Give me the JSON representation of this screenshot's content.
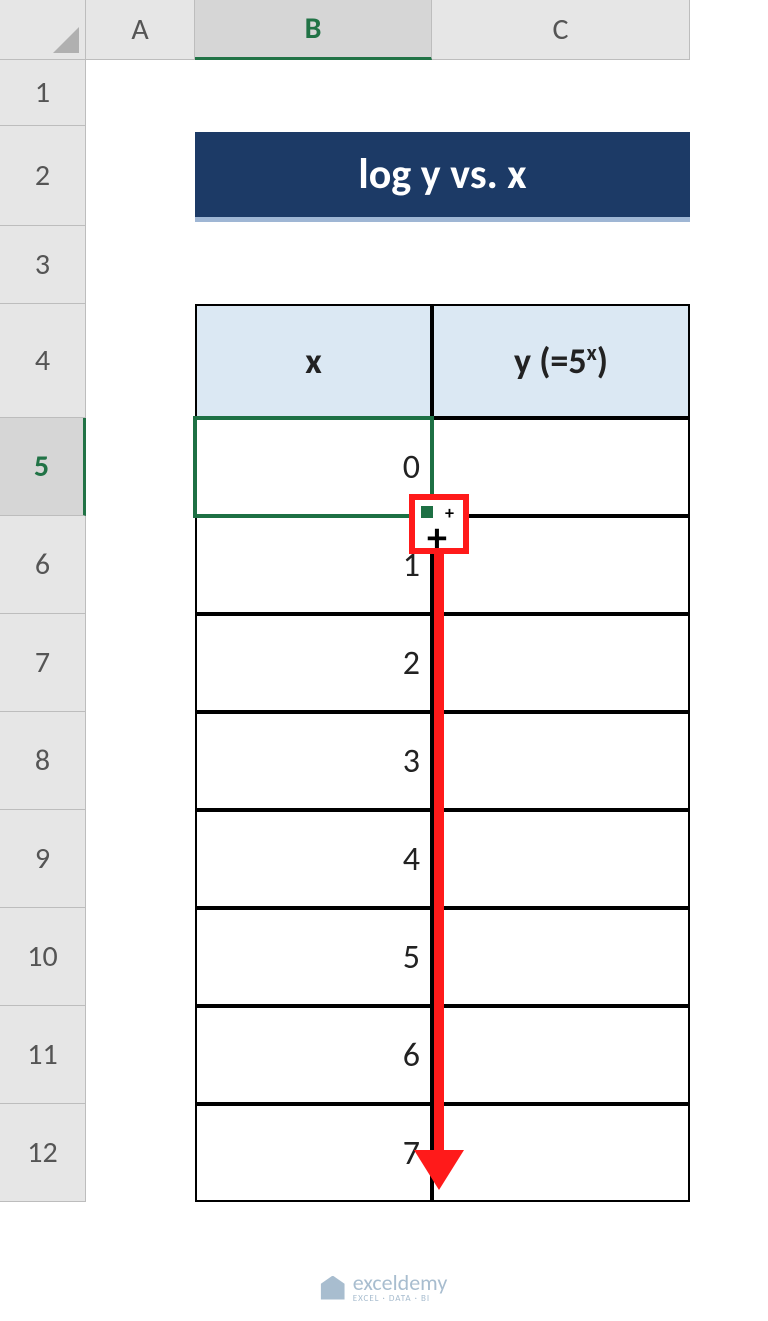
{
  "columns": {
    "A": "A",
    "B": "B",
    "C": "C"
  },
  "rows": [
    "1",
    "2",
    "3",
    "4",
    "5",
    "6",
    "7",
    "8",
    "9",
    "10",
    "11",
    "12"
  ],
  "title": "log y vs. x",
  "table": {
    "headers": {
      "x": "x",
      "y_prefix": "y (=5",
      "y_exp": "x",
      "y_suffix": ")"
    },
    "x_values": [
      "0",
      "1",
      "2",
      "3",
      "4",
      "5",
      "6",
      "7"
    ]
  },
  "watermark": {
    "brand": "exceldemy",
    "tag": "EXCEL · DATA · BI"
  },
  "selected": {
    "col": "B",
    "row": "5"
  }
}
